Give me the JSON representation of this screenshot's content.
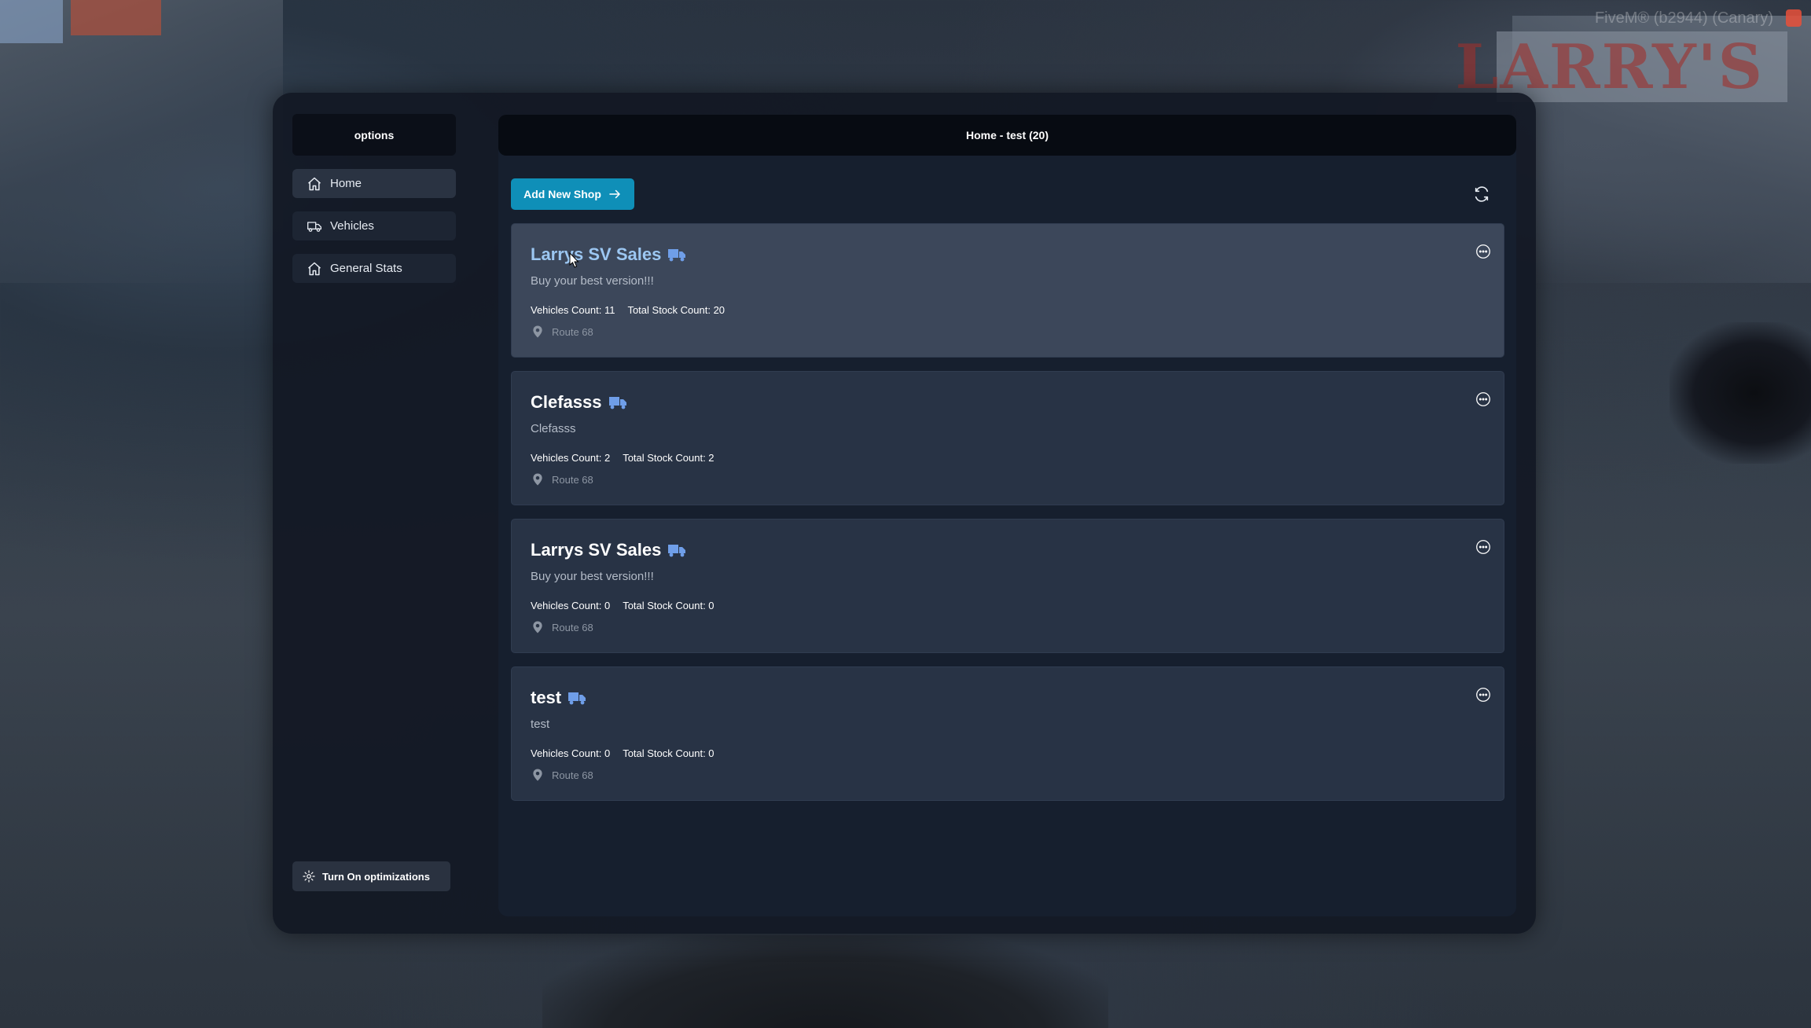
{
  "watermark": "FiveM® (b2944) (Canary)",
  "background_sign": "LARRY'S",
  "sidebar": {
    "header": "options",
    "items": [
      {
        "label": "Home",
        "icon": "home-icon",
        "active": true
      },
      {
        "label": "Vehicles",
        "icon": "truck-icon",
        "active": false
      },
      {
        "label": "General Stats",
        "icon": "home-icon",
        "active": false
      }
    ],
    "optimizations_button": "Turn On optimizations"
  },
  "main": {
    "header": "Home - test (20)",
    "add_shop_label": "Add New Shop",
    "shops": [
      {
        "name": "Larrys SV Sales",
        "description": "Buy your best version!!!",
        "vehicles_count": "Vehicles Count: 11",
        "stock_count": "Total Stock Count: 20",
        "location": "Route 68"
      },
      {
        "name": "Clefasss",
        "description": "Clefasss",
        "vehicles_count": "Vehicles Count: 2",
        "stock_count": "Total Stock Count: 2",
        "location": "Route 68"
      },
      {
        "name": "Larrys SV Sales",
        "description": "Buy your best version!!!",
        "vehicles_count": "Vehicles Count: 0",
        "stock_count": "Total Stock Count: 0",
        "location": "Route 68"
      },
      {
        "name": "test",
        "description": "test",
        "vehicles_count": "Vehicles Count: 0",
        "stock_count": "Total Stock Count: 0",
        "location": "Route 68"
      }
    ]
  },
  "colors": {
    "accent": "#0f8fb8",
    "truck_icon": "#6f9ee8",
    "hover_title": "#9cc7f2"
  }
}
